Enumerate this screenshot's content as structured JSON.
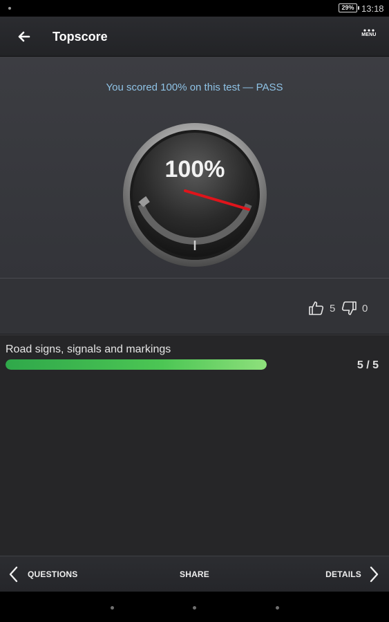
{
  "status_bar": {
    "battery": "29%",
    "time": "13:18"
  },
  "app_bar": {
    "title": "Topscore",
    "menu_label": "MENU"
  },
  "score": {
    "message": "You scored 100% on this test — PASS",
    "gauge_text": "100%",
    "percent": 100
  },
  "votes": {
    "up": "5",
    "down": "0"
  },
  "results": [
    {
      "category": "Road signs, signals and markings",
      "score": "5 / 5",
      "progress": 1.0
    }
  ],
  "bottom_nav": {
    "prev": "QUESTIONS",
    "share": "SHARE",
    "next": "DETAILS"
  },
  "colors": {
    "accent_text": "#8fc3e6",
    "progress_green": "#4cc654",
    "needle": "#e0141b"
  }
}
